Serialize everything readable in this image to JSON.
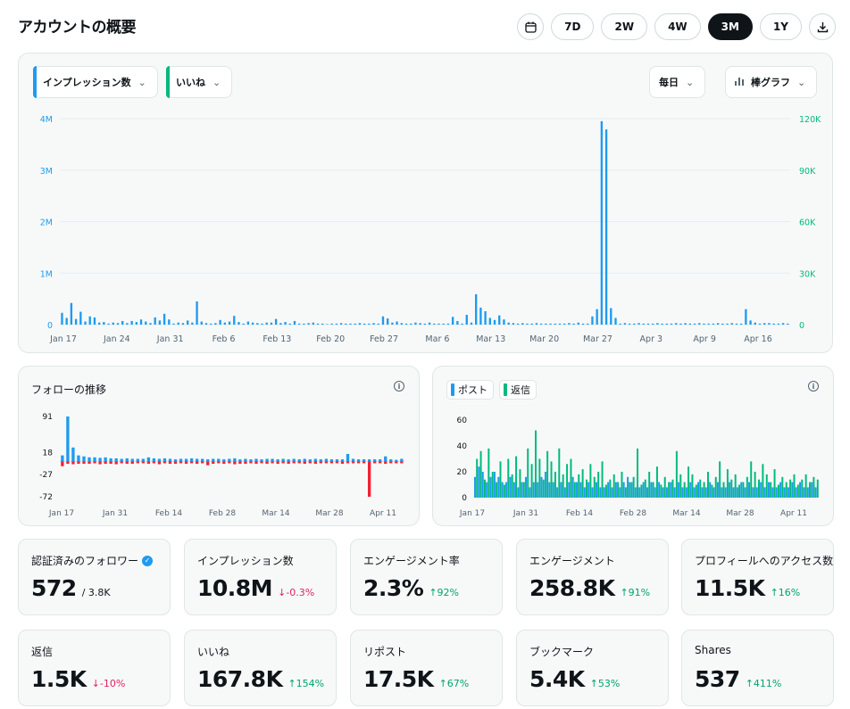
{
  "title": "アカウントの概要",
  "range_buttons": {
    "calendar_icon": "calendar-icon",
    "items": [
      "7D",
      "2W",
      "4W",
      "3M",
      "1Y"
    ],
    "active": "3M",
    "download_icon": "download-icon"
  },
  "main_chart_controls": {
    "metric1": "インプレッション数",
    "metric2": "いいね",
    "interval": "毎日",
    "chart_type": "棒グラフ"
  },
  "colors": {
    "impressions": "#1d9bf0",
    "likes": "#00ba7c",
    "follow_down": "#f4212e",
    "post": "#1d9bf0",
    "reply": "#00ba7c"
  },
  "follow_panel": {
    "title": "フォローの推移"
  },
  "post_panel": {
    "legend_post": "ポスト",
    "legend_reply": "返信"
  },
  "chart_data": [
    {
      "type": "bar",
      "name": "overview",
      "x_ticks": [
        "Jan 17",
        "Jan 24",
        "Jan 31",
        "Feb 6",
        "Feb 13",
        "Feb 20",
        "Feb 27",
        "Mar 6",
        "Mar 13",
        "Mar 20",
        "Mar 27",
        "Apr 3",
        "Apr 9",
        "Apr 16"
      ],
      "y_left_ticks": [
        "0",
        "1M",
        "2M",
        "3M",
        "4M"
      ],
      "y_right_ticks": [
        "0",
        "30K",
        "60K",
        "90K",
        "120K"
      ],
      "ylim_left": [
        0,
        4000000
      ],
      "ylim_right": [
        0,
        120000
      ],
      "series": [
        {
          "name": "インプレッション数",
          "values": [
            230000,
            130000,
            420000,
            110000,
            250000,
            60000,
            160000,
            140000,
            40000,
            50000,
            20000,
            40000,
            30000,
            70000,
            30000,
            70000,
            50000,
            100000,
            60000,
            30000,
            140000,
            80000,
            210000,
            100000,
            20000,
            40000,
            30000,
            80000,
            40000,
            450000,
            60000,
            30000,
            20000,
            30000,
            90000,
            40000,
            60000,
            170000,
            50000,
            20000,
            60000,
            40000,
            30000,
            20000,
            40000,
            40000,
            110000,
            30000,
            50000,
            20000,
            70000,
            20000,
            20000,
            30000,
            40000,
            20000,
            20000,
            10000,
            20000,
            20000,
            30000,
            20000,
            20000,
            20000,
            30000,
            20000,
            20000,
            30000,
            20000,
            160000,
            120000,
            40000,
            60000,
            30000,
            20000,
            20000,
            40000,
            30000,
            20000,
            40000,
            20000,
            20000,
            20000,
            20000,
            150000,
            70000,
            20000,
            190000,
            40000,
            590000,
            330000,
            260000,
            130000,
            90000,
            180000,
            100000,
            40000,
            30000,
            20000,
            30000,
            20000,
            20000,
            30000,
            20000,
            20000,
            20000,
            20000,
            20000,
            20000,
            30000,
            20000,
            40000,
            20000,
            20000,
            160000,
            300000,
            3950000,
            3790000,
            320000,
            130000,
            20000,
            30000,
            20000,
            20000,
            30000,
            20000,
            20000,
            20000,
            30000,
            20000,
            20000,
            20000,
            30000,
            20000,
            30000,
            20000,
            20000,
            30000,
            20000,
            20000,
            20000,
            30000,
            20000,
            20000,
            30000,
            20000,
            20000,
            300000,
            80000,
            40000,
            20000,
            30000,
            30000,
            20000,
            20000,
            30000,
            20000
          ]
        }
      ]
    },
    {
      "type": "bar",
      "name": "follows",
      "x_ticks": [
        "Jan 17",
        "Jan 31",
        "Feb 14",
        "Feb 28",
        "Mar 14",
        "Mar 28",
        "Apr 11"
      ],
      "y_ticks": [
        "-72",
        "-27",
        "18",
        "91"
      ],
      "ylim": [
        -72,
        91
      ],
      "series": [
        {
          "name": "gain",
          "values": [
            12,
            91,
            28,
            12,
            10,
            8,
            8,
            7,
            8,
            6,
            6,
            5,
            6,
            5,
            5,
            5,
            8,
            6,
            5,
            6,
            5,
            4,
            5,
            5,
            6,
            5,
            5,
            4,
            5,
            5,
            4,
            5,
            6,
            4,
            5,
            4,
            5,
            4,
            5,
            5,
            4,
            5,
            4,
            5,
            4,
            5,
            4,
            5,
            4,
            5,
            4,
            4,
            4,
            15,
            5,
            4,
            4,
            4,
            4,
            4,
            10,
            4,
            3,
            5
          ]
        },
        {
          "name": "loss",
          "values": [
            -10,
            -5,
            -6,
            -5,
            -5,
            -5,
            -4,
            -6,
            -5,
            -5,
            -6,
            -4,
            -5,
            -5,
            -4,
            -4,
            -5,
            -4,
            -6,
            -4,
            -5,
            -5,
            -4,
            -5,
            -4,
            -5,
            -4,
            -8,
            -5,
            -4,
            -5,
            -4,
            -6,
            -5,
            -5,
            -4,
            -5,
            -4,
            -5,
            -4,
            -5,
            -4,
            -5,
            -4,
            -4,
            -5,
            -4,
            -5,
            -4,
            -4,
            -4,
            -4,
            -5,
            -4,
            -4,
            -4,
            -4,
            -72,
            -4,
            -4,
            -5,
            -4,
            -4,
            -4
          ]
        }
      ]
    },
    {
      "type": "bar",
      "name": "posts_replies",
      "x_ticks": [
        "Jan 17",
        "Jan 31",
        "Feb 14",
        "Feb 28",
        "Mar 14",
        "Mar 28",
        "Apr 11"
      ],
      "y_ticks": [
        "0",
        "20",
        "40",
        "60"
      ],
      "ylim": [
        0,
        60
      ],
      "series": [
        {
          "name": "ポスト",
          "values": [
            4,
            6,
            5,
            3,
            4,
            5,
            4,
            3,
            3,
            4,
            3,
            2,
            3,
            4,
            2,
            3,
            3,
            4,
            5,
            3,
            3,
            2,
            3,
            2,
            3,
            4,
            3,
            3,
            2,
            3,
            2,
            3,
            2,
            2,
            3,
            2,
            3,
            2,
            3,
            4,
            3,
            2,
            2,
            3,
            2,
            3,
            2,
            3,
            2,
            2,
            3,
            2,
            3,
            2,
            2,
            3,
            2,
            3,
            2,
            2,
            3,
            2,
            3,
            2,
            2,
            3,
            2,
            2,
            3,
            2,
            3,
            2,
            2,
            3,
            2,
            3,
            2,
            2,
            3,
            2,
            2,
            3,
            2,
            3,
            2,
            2,
            3,
            2
          ]
        },
        {
          "name": "返信",
          "values": [
            30,
            36,
            14,
            38,
            20,
            12,
            28,
            10,
            30,
            18,
            32,
            22,
            12,
            38,
            26,
            52,
            30,
            14,
            36,
            28,
            20,
            38,
            18,
            26,
            30,
            12,
            18,
            22,
            14,
            26,
            16,
            20,
            28,
            10,
            14,
            18,
            12,
            20,
            8,
            12,
            16,
            38,
            10,
            14,
            20,
            12,
            24,
            10,
            16,
            12,
            14,
            36,
            18,
            12,
            24,
            18,
            10,
            14,
            12,
            20,
            10,
            16,
            28,
            12,
            22,
            14,
            18,
            10,
            12,
            16,
            28,
            20,
            14,
            26,
            18,
            12,
            22,
            10,
            16,
            12,
            14,
            18,
            10,
            14,
            18,
            12,
            16,
            14
          ]
        }
      ]
    }
  ],
  "stats": [
    {
      "label": "認証済みのフォロワー",
      "value": "572",
      "sub": "/ 3.8K",
      "change": "",
      "dir": ""
    },
    {
      "label": "インプレッション数",
      "value": "10.8M",
      "sub": "",
      "change": "-0.3%",
      "dir": "down"
    },
    {
      "label": "エンゲージメント率",
      "value": "2.3%",
      "sub": "",
      "change": "92%",
      "dir": "up"
    },
    {
      "label": "エンゲージメント",
      "value": "258.8K",
      "sub": "",
      "change": "91%",
      "dir": "up"
    },
    {
      "label": "プロフィールへのアクセス数",
      "value": "11.5K",
      "sub": "",
      "change": "16%",
      "dir": "up"
    },
    {
      "label": "返信",
      "value": "1.5K",
      "sub": "",
      "change": "-10%",
      "dir": "down"
    },
    {
      "label": "いいね",
      "value": "167.8K",
      "sub": "",
      "change": "154%",
      "dir": "up"
    },
    {
      "label": "リポスト",
      "value": "17.5K",
      "sub": "",
      "change": "67%",
      "dir": "up"
    },
    {
      "label": "ブックマーク",
      "value": "5.4K",
      "sub": "",
      "change": "53%",
      "dir": "up"
    },
    {
      "label": "Shares",
      "value": "537",
      "sub": "",
      "change": "411%",
      "dir": "up"
    }
  ]
}
